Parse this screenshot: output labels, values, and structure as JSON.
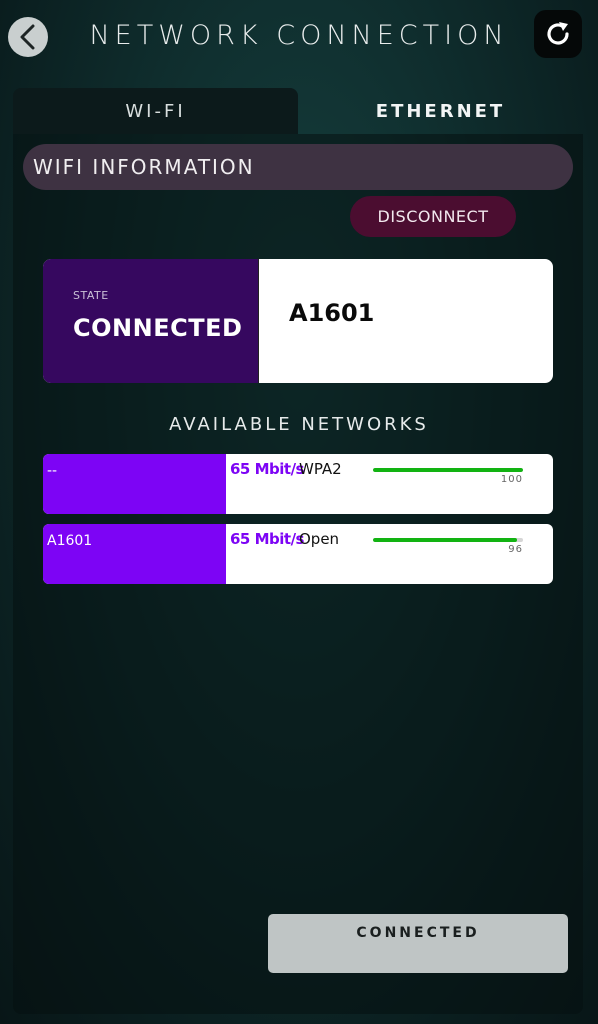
{
  "header": {
    "title": "NETWORK CONNECTION",
    "back_icon": "chevron-left-icon",
    "refresh_icon": "refresh-icon"
  },
  "tabs": [
    {
      "label": "WI-FI",
      "active": true
    },
    {
      "label": "ETHERNET",
      "active": false
    }
  ],
  "wifi_info": {
    "section_title": "WIFI INFORMATION",
    "disconnect_label": "DISCONNECT",
    "state_label": "STATE",
    "state_value": "CONNECTED",
    "ssid": "A1601"
  },
  "available": {
    "title": "AVAILABLE NETWORKS",
    "networks": [
      {
        "name": "--",
        "speed": "65 Mbit/s",
        "security": "WPA2",
        "signal": 100,
        "signal_label": "100"
      },
      {
        "name": "A1601",
        "speed": "65 Mbit/s",
        "security": "Open",
        "signal": 96,
        "signal_label": "96"
      }
    ]
  },
  "footer": {
    "button_label": "CONNECTED"
  },
  "colors": {
    "accent_purple": "#7d04f5",
    "state_bg": "#36085f",
    "disconnect_bg": "#4b0d30",
    "signal_green": "#12b312"
  }
}
